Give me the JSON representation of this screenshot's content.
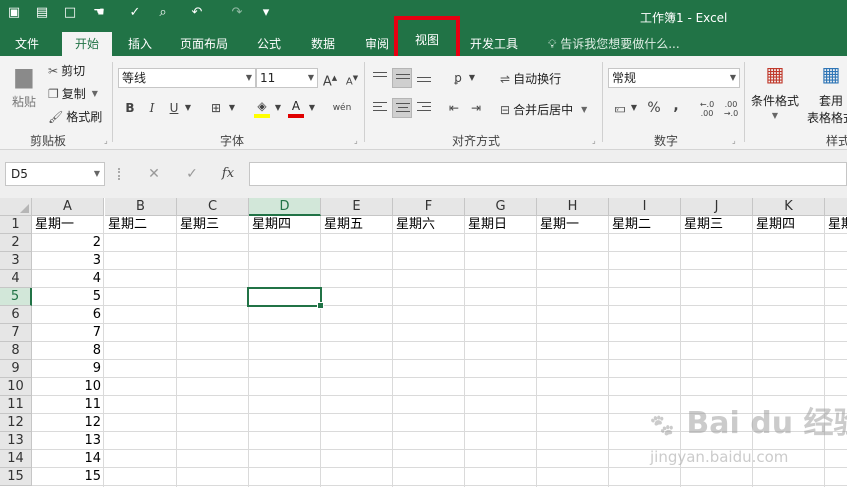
{
  "window": {
    "title": "工作簿1 - Excel",
    "quick_access": [
      {
        "name": "save-icon",
        "glyph": "▣"
      },
      {
        "name": "open-icon",
        "glyph": "▤"
      },
      {
        "name": "new-doc-icon",
        "glyph": "□"
      },
      {
        "name": "touch-mode-icon",
        "glyph": "☚"
      },
      {
        "name": "spellcheck-icon",
        "glyph": "✓"
      },
      {
        "name": "print-preview-icon",
        "glyph": "⌕"
      },
      {
        "name": "undo-icon",
        "glyph": "↶"
      },
      {
        "name": "redo-icon",
        "glyph": "↷"
      },
      {
        "name": "customize-qa-icon",
        "glyph": "▾"
      }
    ]
  },
  "tabs": [
    {
      "label": "文件"
    },
    {
      "label": "开始"
    },
    {
      "label": "插入"
    },
    {
      "label": "页面布局"
    },
    {
      "label": "公式"
    },
    {
      "label": "数据"
    },
    {
      "label": "审阅"
    },
    {
      "label": "视图"
    },
    {
      "label": "开发工具"
    }
  ],
  "tell_me": {
    "text": "告诉我您想要做什么..."
  },
  "ribbon": {
    "clipboard": {
      "paste": "粘贴",
      "cut": "剪切",
      "copy": "复制",
      "format_painter": "格式刷",
      "label": "剪贴板"
    },
    "font": {
      "font_name": "等线",
      "font_size": "11",
      "bold": "B",
      "italic": "I",
      "underline": "U",
      "grow": "A",
      "shrink": "A",
      "phonetic": "wén",
      "label": "字体"
    },
    "alignment": {
      "wrap_text": "自动换行",
      "merge_center": "合并后居中",
      "label": "对齐方式"
    },
    "number": {
      "format": "常规",
      "percent": "%",
      "comma": ",",
      "label": "数字"
    },
    "styles": {
      "conditional": "条件格式",
      "table_format": "套用",
      "table_format2": "表格格式",
      "label": "样式"
    }
  },
  "formula_bar": {
    "name_box": "D5",
    "cancel": "✕",
    "enter": "✓",
    "fx": "fx",
    "value": ""
  },
  "sheet": {
    "columns": [
      "A",
      "B",
      "C",
      "D",
      "E",
      "F",
      "G",
      "H",
      "I",
      "J",
      "K",
      ""
    ],
    "rows": [
      "1",
      "2",
      "3",
      "4",
      "5",
      "6",
      "7",
      "8",
      "9",
      "10",
      "11",
      "12",
      "13",
      "14",
      "15"
    ],
    "selected_cell": "D5",
    "row1": [
      "星期一",
      "星期二",
      "星期三",
      "星期四",
      "星期五",
      "星期六",
      "星期日",
      "星期一",
      "星期二",
      "星期三",
      "星期四",
      "星期"
    ],
    "col_a": [
      "2",
      "3",
      "4",
      "5",
      "6",
      "7",
      "8",
      "9",
      "10",
      "11",
      "12",
      "13",
      "14",
      "15"
    ]
  },
  "watermark": {
    "logo": "Bai du 经验",
    "url": "jingyan.baidu.com"
  }
}
